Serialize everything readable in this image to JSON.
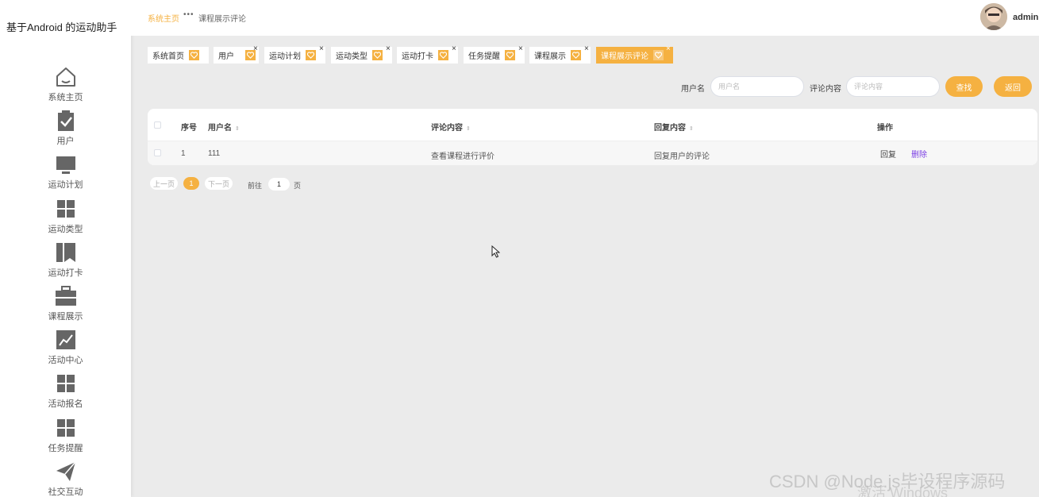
{
  "app": {
    "title": "基于Android 的运动助手"
  },
  "sidebar": {
    "items": [
      {
        "label": "系统主页",
        "icon": "home-icon"
      },
      {
        "label": "用户",
        "icon": "clipboard-check-icon"
      },
      {
        "label": "运动计划",
        "icon": "monitor-icon"
      },
      {
        "label": "运动类型",
        "icon": "grid-icon"
      },
      {
        "label": "运动打卡",
        "icon": "book-icon"
      },
      {
        "label": "课程展示",
        "icon": "briefcase-icon"
      },
      {
        "label": "活动中心",
        "icon": "chart-icon"
      },
      {
        "label": "活动报名",
        "icon": "grid-icon"
      },
      {
        "label": "任务提醒",
        "icon": "grid-icon"
      },
      {
        "label": "社交互动",
        "icon": "paper-plane-icon"
      }
    ]
  },
  "header": {
    "breadcrumb_home": "系统主页",
    "breadcrumb_sep": "•••",
    "breadcrumb_current": "课程展示评论",
    "username": "admin"
  },
  "tabs": [
    {
      "label": "系统首页",
      "closable": false
    },
    {
      "label": "用户",
      "closable": true
    },
    {
      "label": "运动计划",
      "closable": true
    },
    {
      "label": "运动类型",
      "closable": true
    },
    {
      "label": "运动打卡",
      "closable": true
    },
    {
      "label": "任务提醒",
      "closable": true
    },
    {
      "label": "课程展示",
      "closable": true
    },
    {
      "label": "课程展示评论",
      "closable": true,
      "active": true
    }
  ],
  "tab_close_glyph": "×",
  "search": {
    "username_label": "用户名",
    "username_placeholder": "用户名",
    "comment_label": "评论内容",
    "comment_placeholder": "评论内容",
    "search_button": "查找",
    "back_button": "返回"
  },
  "table": {
    "columns": [
      "序号",
      "用户名",
      "评论内容",
      "回复内容",
      "操作"
    ],
    "sort_glyph": "⇕",
    "rows": [
      {
        "index": "1",
        "username": "111",
        "comment": "查看课程进行评价",
        "reply": "回复用户的评论",
        "actions": [
          "回复",
          "删除"
        ]
      }
    ]
  },
  "pagination": {
    "prev": "上一页",
    "current_page": "1",
    "next": "下一页",
    "goto_label": "前往",
    "goto_value": "1",
    "page_suffix": "页"
  },
  "watermarks": {
    "csdn": "CSDN @Node.js毕设程序源码",
    "windows": "激活 Windows"
  },
  "colors": {
    "accent": "#f5b141",
    "delete_link": "#7b3fe4"
  }
}
